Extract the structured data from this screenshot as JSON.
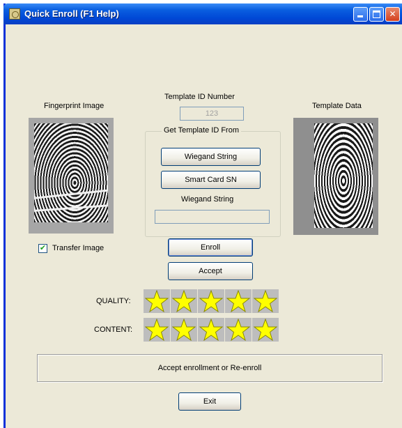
{
  "window": {
    "title": "Quick Enroll (F1 Help)",
    "accent": "#0048d6",
    "background": "#ece9d8"
  },
  "titlebar_icons": [
    "app-icon",
    "minimize-icon",
    "maximize-icon",
    "close-icon"
  ],
  "fingerprint": {
    "label": "Fingerprint Image",
    "transfer_label": "Transfer Image",
    "transfer_checked": true
  },
  "template_id": {
    "label": "Template ID Number",
    "value": "123"
  },
  "source_group": {
    "title": "Get Template ID From",
    "wiegand_button": "Wiegand String",
    "smartcard_button": "Smart Card SN",
    "wiegand_label": "Wiegand String",
    "wiegand_value": ""
  },
  "template_data": {
    "label": "Template Data"
  },
  "actions": {
    "enroll": "Enroll",
    "accept": "Accept",
    "exit": "Exit"
  },
  "ratings": {
    "quality_label": "QUALITY:",
    "quality_stars": 5,
    "content_label": "CONTENT:",
    "content_stars": 5,
    "max_stars": 5,
    "star_color": "#ffff00"
  },
  "status": {
    "message": "Accept enrollment or Re-enroll"
  }
}
